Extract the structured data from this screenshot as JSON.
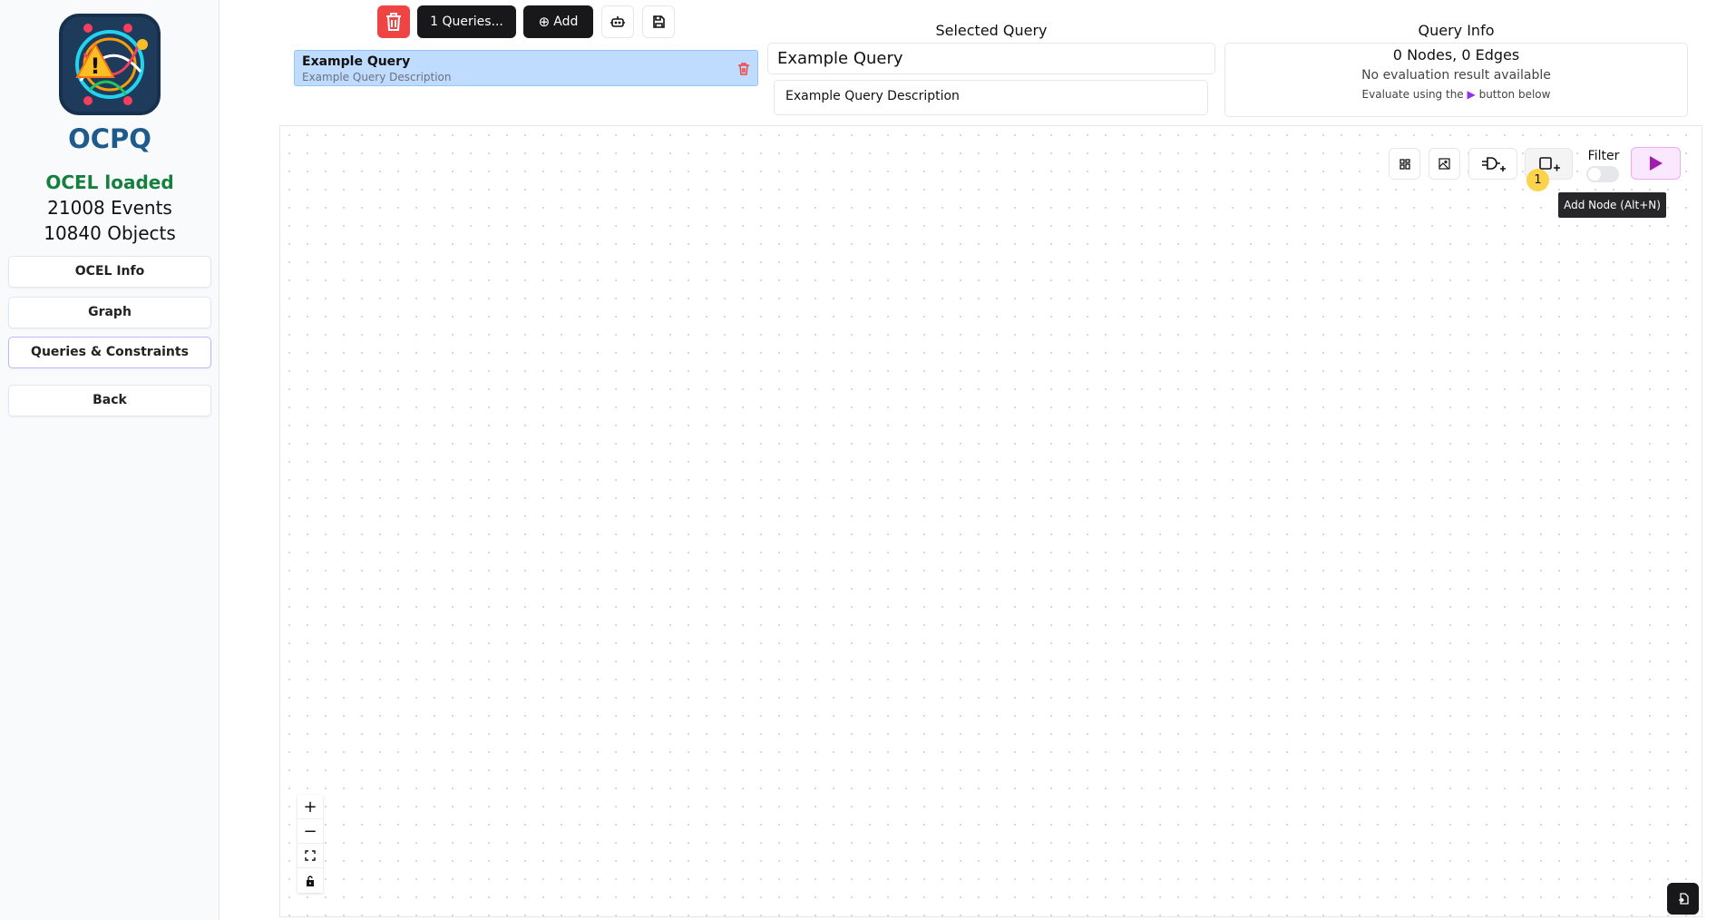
{
  "sidebar": {
    "brand": "OCPQ",
    "ocel_status": "OCEL loaded",
    "events": "21008 Events",
    "objects": "10840 Objects",
    "nav": [
      {
        "label": "OCEL Info"
      },
      {
        "label": "Graph"
      },
      {
        "label": "Queries & Constraints",
        "active": true
      },
      {
        "label": "Back"
      }
    ]
  },
  "toolbar": {
    "queries_label": "1 Queries...",
    "add_label": "Add",
    "delete_icon": "trash-icon",
    "robot_icon": "robot-icon",
    "save_icon": "save-icon"
  },
  "query_list": [
    {
      "name": "Example Query",
      "description": "Example Query Description"
    }
  ],
  "selected_query": {
    "heading": "Selected Query",
    "name_value": "Example Query",
    "description_value": "Example Query Description"
  },
  "query_info": {
    "heading": "Query Info",
    "counts": "0 Nodes, 0 Edges",
    "status": "No evaluation result available",
    "hint_before": "Evaluate using the",
    "hint_after": "button below"
  },
  "canvas_toolbar": {
    "filter_label": "Filter",
    "filter_on": false,
    "badge": "1",
    "tooltip": "Add Node (Alt+N)"
  },
  "colors": {
    "accent": "#a21caf",
    "selected_row": "#bfdbfe",
    "danger": "#ef4444",
    "ocel_loaded": "#15803d",
    "badge": "#fcd34d"
  }
}
